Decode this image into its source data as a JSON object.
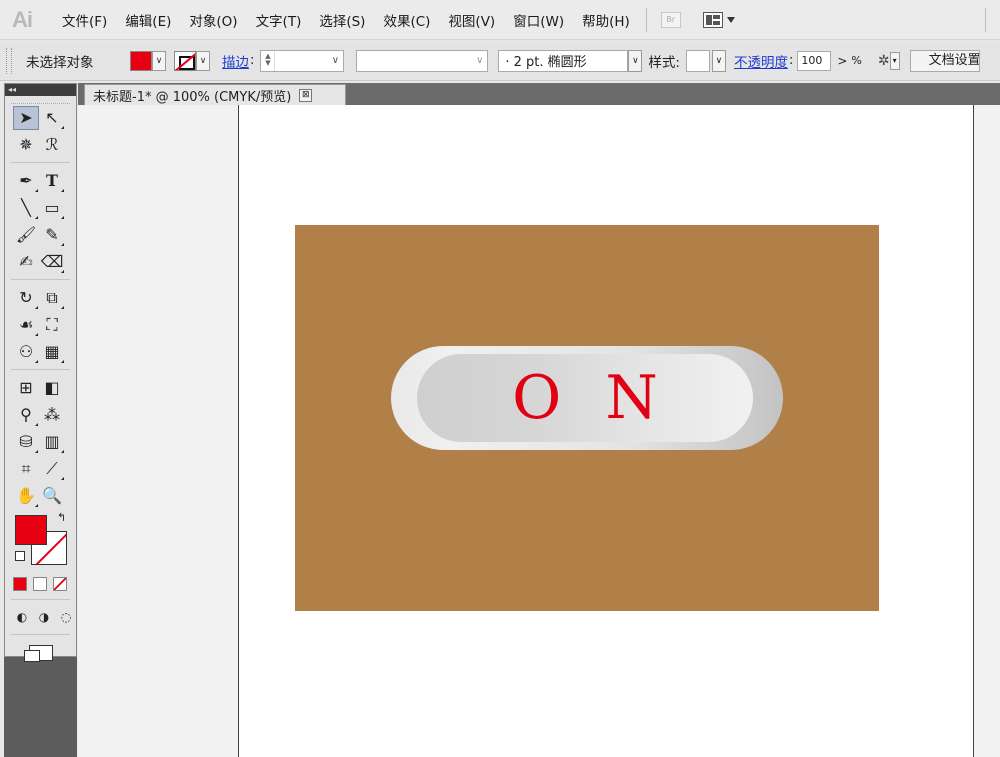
{
  "app": {
    "logo": "Ai"
  },
  "menu": [
    "文件(F)",
    "编辑(E)",
    "对象(O)",
    "文字(T)",
    "选择(S)",
    "效果(C)",
    "视图(V)",
    "窗口(W)",
    "帮助(H)"
  ],
  "bridge_label": "Br",
  "control": {
    "selection_status": "未选择对象",
    "fill_color": "#e60012",
    "stroke_label": "描边",
    "brush_value": "· 2 pt. 椭圆形",
    "style_label": "样式:",
    "opacity_label": "不透明度",
    "opacity_value": "100",
    "opacity_arrow": ">",
    "percent": "%",
    "doc_setup": "文档设置"
  },
  "document": {
    "tab_title": "未标题-1* @ 100% (CMYK/预览)",
    "close": "⊠"
  },
  "canvas": {
    "background_color": "#b08048",
    "button_text": "ON",
    "text_color": "#e00012"
  },
  "toolbox": {
    "header": "◂◂",
    "tools": [
      [
        "selection-icon",
        "direct-selection-icon"
      ],
      [
        "magic-wand-icon",
        "lasso-icon"
      ],
      [
        "pen-icon",
        "type-icon"
      ],
      [
        "line-segment-icon",
        "rectangle-icon"
      ],
      [
        "paintbrush-icon",
        "pencil-icon"
      ],
      [
        "blob-brush-icon",
        "eraser-icon"
      ],
      [
        "rotate-icon",
        "scale-icon"
      ],
      [
        "warp-icon",
        "free-transform-icon"
      ],
      [
        "shape-builder-icon",
        "perspective-grid-icon"
      ],
      [
        "mesh-icon",
        "gradient-icon"
      ],
      [
        "eyedropper-icon",
        "blend-icon"
      ],
      [
        "symbol-sprayer-icon",
        "column-graph-icon"
      ],
      [
        "artboard-icon",
        "slice-icon"
      ],
      [
        "hand-icon",
        "zoom-icon"
      ]
    ]
  }
}
